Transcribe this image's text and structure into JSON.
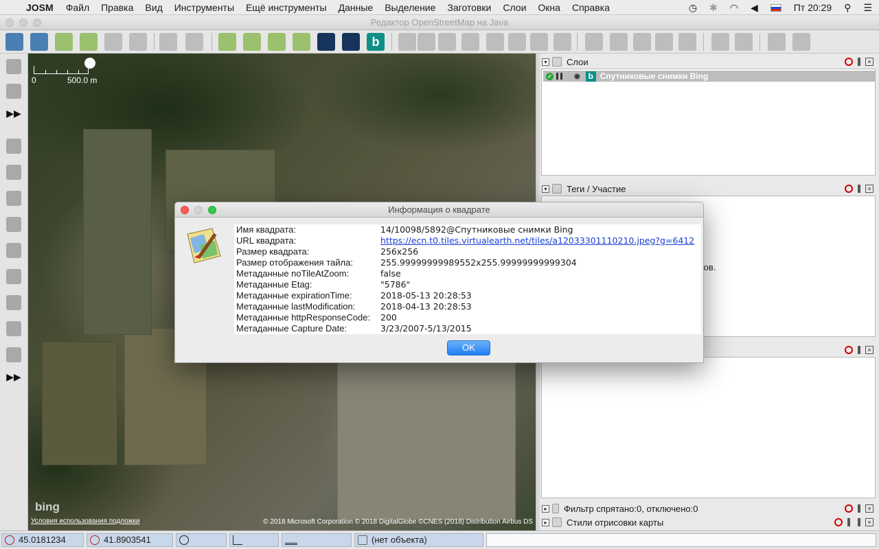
{
  "menubar": {
    "app": "JOSM",
    "items": [
      "Файл",
      "Правка",
      "Вид",
      "Инструменты",
      "Ещё инструменты",
      "Данные",
      "Выделение",
      "Заготовки",
      "Слои",
      "Окна",
      "Справка"
    ],
    "clock": "Пт 20:29"
  },
  "window": {
    "title": "Редактор OpenStreetMap на Java"
  },
  "map": {
    "scale_start": "0",
    "scale_end": "500.0 m",
    "logo": "bing",
    "terms": "Условия использования подложки",
    "attribution": "© 2018 Microsoft Corporation © 2018 DigitalGlobe ©CNES (2018) Distribution Airbus DS"
  },
  "panels": {
    "layers": {
      "title": "Слои",
      "layer_name": "Спутниковые снимки Bing"
    },
    "tags": {
      "title": "Теги / Участие",
      "partial_text": "егов."
    },
    "filter": {
      "title": "Фильтр спрятано:0, отключено:0"
    },
    "styles": {
      "title": "Стили отрисовки карты"
    }
  },
  "status": {
    "lat": "45.0181234",
    "lon": "41.8903541",
    "object": "(нет объекта)"
  },
  "dialog": {
    "title": "Информация о квадрате",
    "rows": [
      {
        "key": "Имя квадрата:",
        "value": "14/10098/5892@Спутниковые снимки Bing"
      },
      {
        "key": "URL квадрата:",
        "value": "https://ecn.t0.tiles.virtualearth.net/tiles/a12033301110210.jpeg?g=6412"
      },
      {
        "key": "Размер квадрата:",
        "value": "256x256"
      },
      {
        "key": "Размер отображения тайла:",
        "value": "255.99999999989552x255.99999999999304"
      },
      {
        "key": "Метаданные noTileAtZoom:",
        "value": "false"
      },
      {
        "key": "Метаданные Etag:",
        "value": "\"5786\""
      },
      {
        "key": "Метаданные expirationTime:",
        "value": "2018-05-13 20:28:53"
      },
      {
        "key": "Метаданные lastModification:",
        "value": "2018-04-13 20:28:53"
      },
      {
        "key": "Метаданные httpResponseCode:",
        "value": "200"
      },
      {
        "key": "Метаданные Capture Date:",
        "value": "3/23/2007-5/13/2015"
      }
    ],
    "ok_label": "OK"
  },
  "colors": {
    "ok_button": "#1f7ef5",
    "link": "#1a3fd6",
    "status_field": "#c8d7ea",
    "bing_brand": "#0d8f86"
  }
}
